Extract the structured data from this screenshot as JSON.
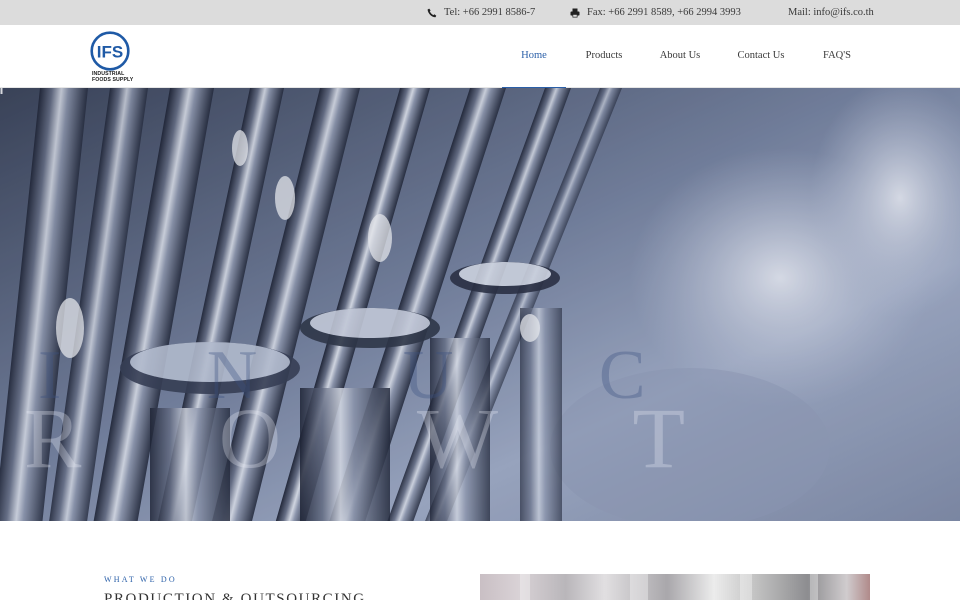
{
  "topbar": {
    "tel": "Tel: +66 2991 8586-7",
    "fax": "Fax: +66 2991 8589, +66 2994 3993",
    "mail": "Mail: info@ifs.co.th",
    "icons": [
      "phone-icon",
      "fax-icon"
    ]
  },
  "logo": {
    "mark": "IFS",
    "line1": "INDUSTRIAL",
    "line2": "FOODS SUPPLY",
    "color": "#1f5aa6"
  },
  "nav": {
    "items": [
      {
        "label": "Home",
        "active": true
      },
      {
        "label": "Products",
        "active": false
      },
      {
        "label": "About Us",
        "active": false
      },
      {
        "label": "Contact Us",
        "active": false
      },
      {
        "label": "FAQ'S",
        "active": false
      }
    ],
    "accent": "#2a5fa8"
  },
  "hero": {
    "line1": "I  N  U  C",
    "line2": "R  O  W  T",
    "image": "industrial-bottling-machinery"
  },
  "section": {
    "eyebrow": "WHAT WE DO",
    "title": "PRODUCTION & OUTSOURCING"
  }
}
